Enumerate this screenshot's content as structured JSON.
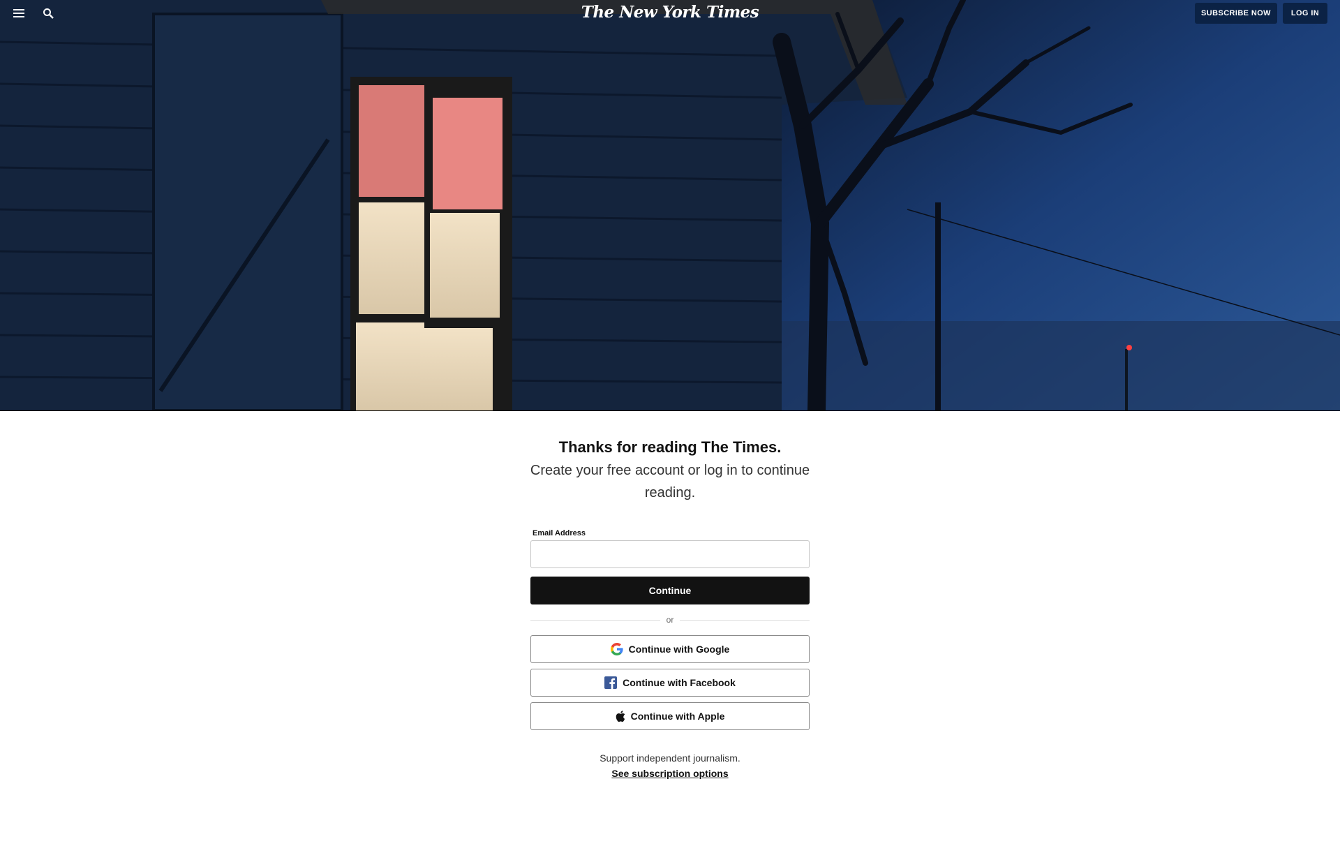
{
  "header": {
    "logo_text": "The New York Times",
    "subscribe_label": "SUBSCRIBE NOW",
    "login_label": "LOG IN"
  },
  "main": {
    "headline": "Thanks for reading The Times.",
    "subhead": "Create your free account or log in to continue reading.",
    "email_label": "Email Address",
    "email_value": "",
    "email_placeholder": "",
    "continue_label": "Continue",
    "divider_text": "or",
    "social_buttons": [
      {
        "label": "Continue with Google",
        "icon": "google-icon"
      },
      {
        "label": "Continue with Facebook",
        "icon": "facebook-icon"
      },
      {
        "label": "Continue with Apple",
        "icon": "apple-icon"
      }
    ],
    "support_text": "Support independent journalism.",
    "subscription_link": "See subscription options"
  },
  "colors": {
    "primary_button": "#121212",
    "header_button": "#0b2245",
    "facebook_blue": "#3b5998"
  }
}
